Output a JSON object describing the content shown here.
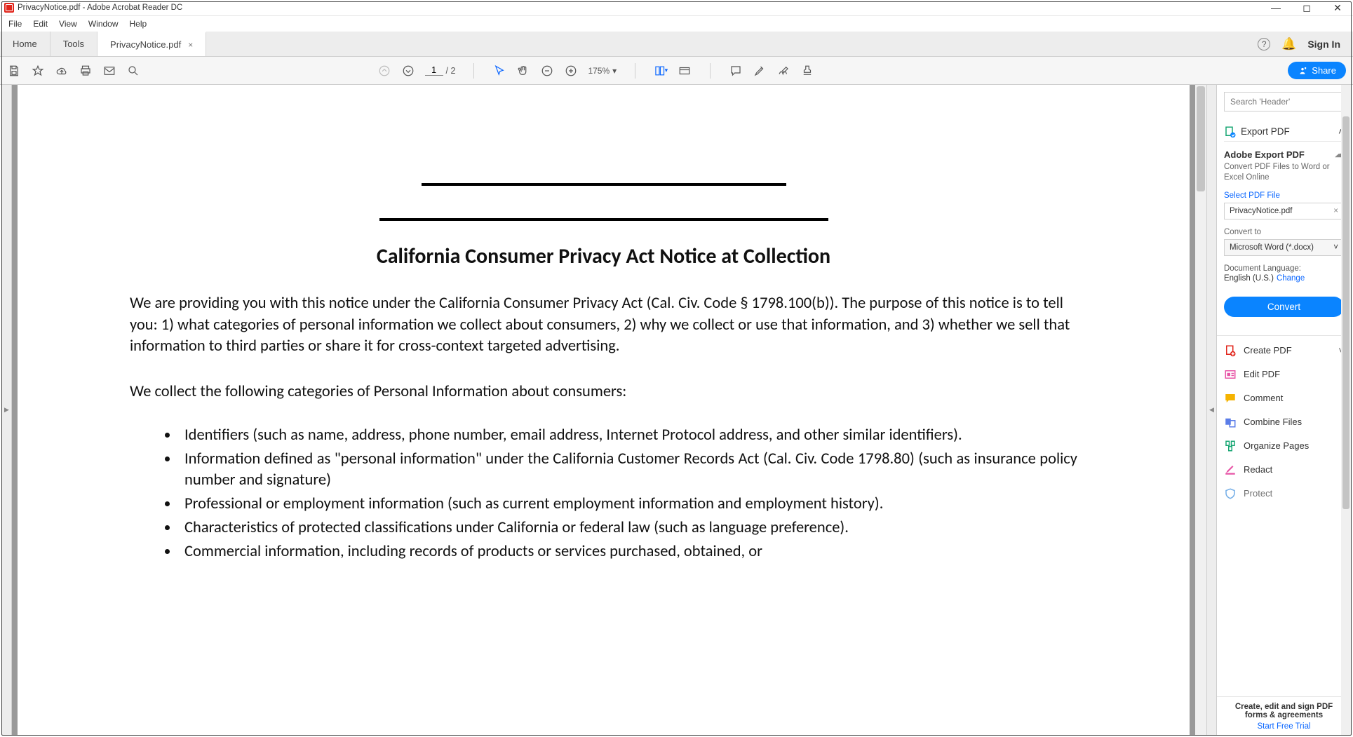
{
  "window": {
    "title": "PrivacyNotice.pdf - Adobe Acrobat Reader DC"
  },
  "menubar": [
    "File",
    "Edit",
    "View",
    "Window",
    "Help"
  ],
  "tabs": {
    "home": "Home",
    "tools": "Tools",
    "doc": "PrivacyNotice.pdf",
    "help_tooltip": "?",
    "signin": "Sign In"
  },
  "toolbar": {
    "page_current": "1",
    "page_total": "/ 2",
    "zoom": "175%",
    "share": "Share"
  },
  "document": {
    "heading": "California Consumer Privacy Act Notice at Collection",
    "p1": "We are providing you with this notice under the California Consumer Privacy Act (Cal. Civ. Code § 1798.100(b)).  The purpose of this notice is to tell you: 1) what categories of personal information we collect about consumers, 2) why we collect or use that information, and 3) whether we sell that information to third parties or share it for cross-context targeted advertising.",
    "p2": "We collect the following categories of Personal Information about consumers:",
    "bullets": [
      "Identifiers (such as name, address, phone number, email address, Internet Protocol address, and other similar identifiers).",
      "Information defined as \"personal information\" under the California Customer Records Act (Cal. Civ. Code 1798.80) (such as insurance policy number and signature)",
      "Professional or employment information (such as current employment information and employment history).",
      "Characteristics of protected classifications under California or federal law (such as language preference).",
      "Commercial information, including records of products or services purchased, obtained, or"
    ]
  },
  "right_panel": {
    "search_placeholder": "Search 'Header'",
    "export_pdf": "Export PDF",
    "sub_title": "Adobe Export PDF",
    "sub_desc": "Convert PDF Files to Word or Excel Online",
    "select_label": "Select PDF File",
    "selected_file": "PrivacyNotice.pdf",
    "convert_to_label": "Convert to",
    "convert_to_value": "Microsoft Word (*.docx)",
    "lang_label": "Document Language:",
    "lang_value": "English (U.S.)",
    "lang_change": "Change",
    "convert_btn": "Convert",
    "tools": [
      {
        "label": "Create PDF",
        "chev": true
      },
      {
        "label": "Edit PDF"
      },
      {
        "label": "Comment"
      },
      {
        "label": "Combine Files"
      },
      {
        "label": "Organize Pages"
      },
      {
        "label": "Redact"
      },
      {
        "label": "Protect"
      }
    ],
    "footer1": "Create, edit and sign PDF",
    "footer2": "forms & agreements",
    "footer_link": "Start Free Trial"
  }
}
